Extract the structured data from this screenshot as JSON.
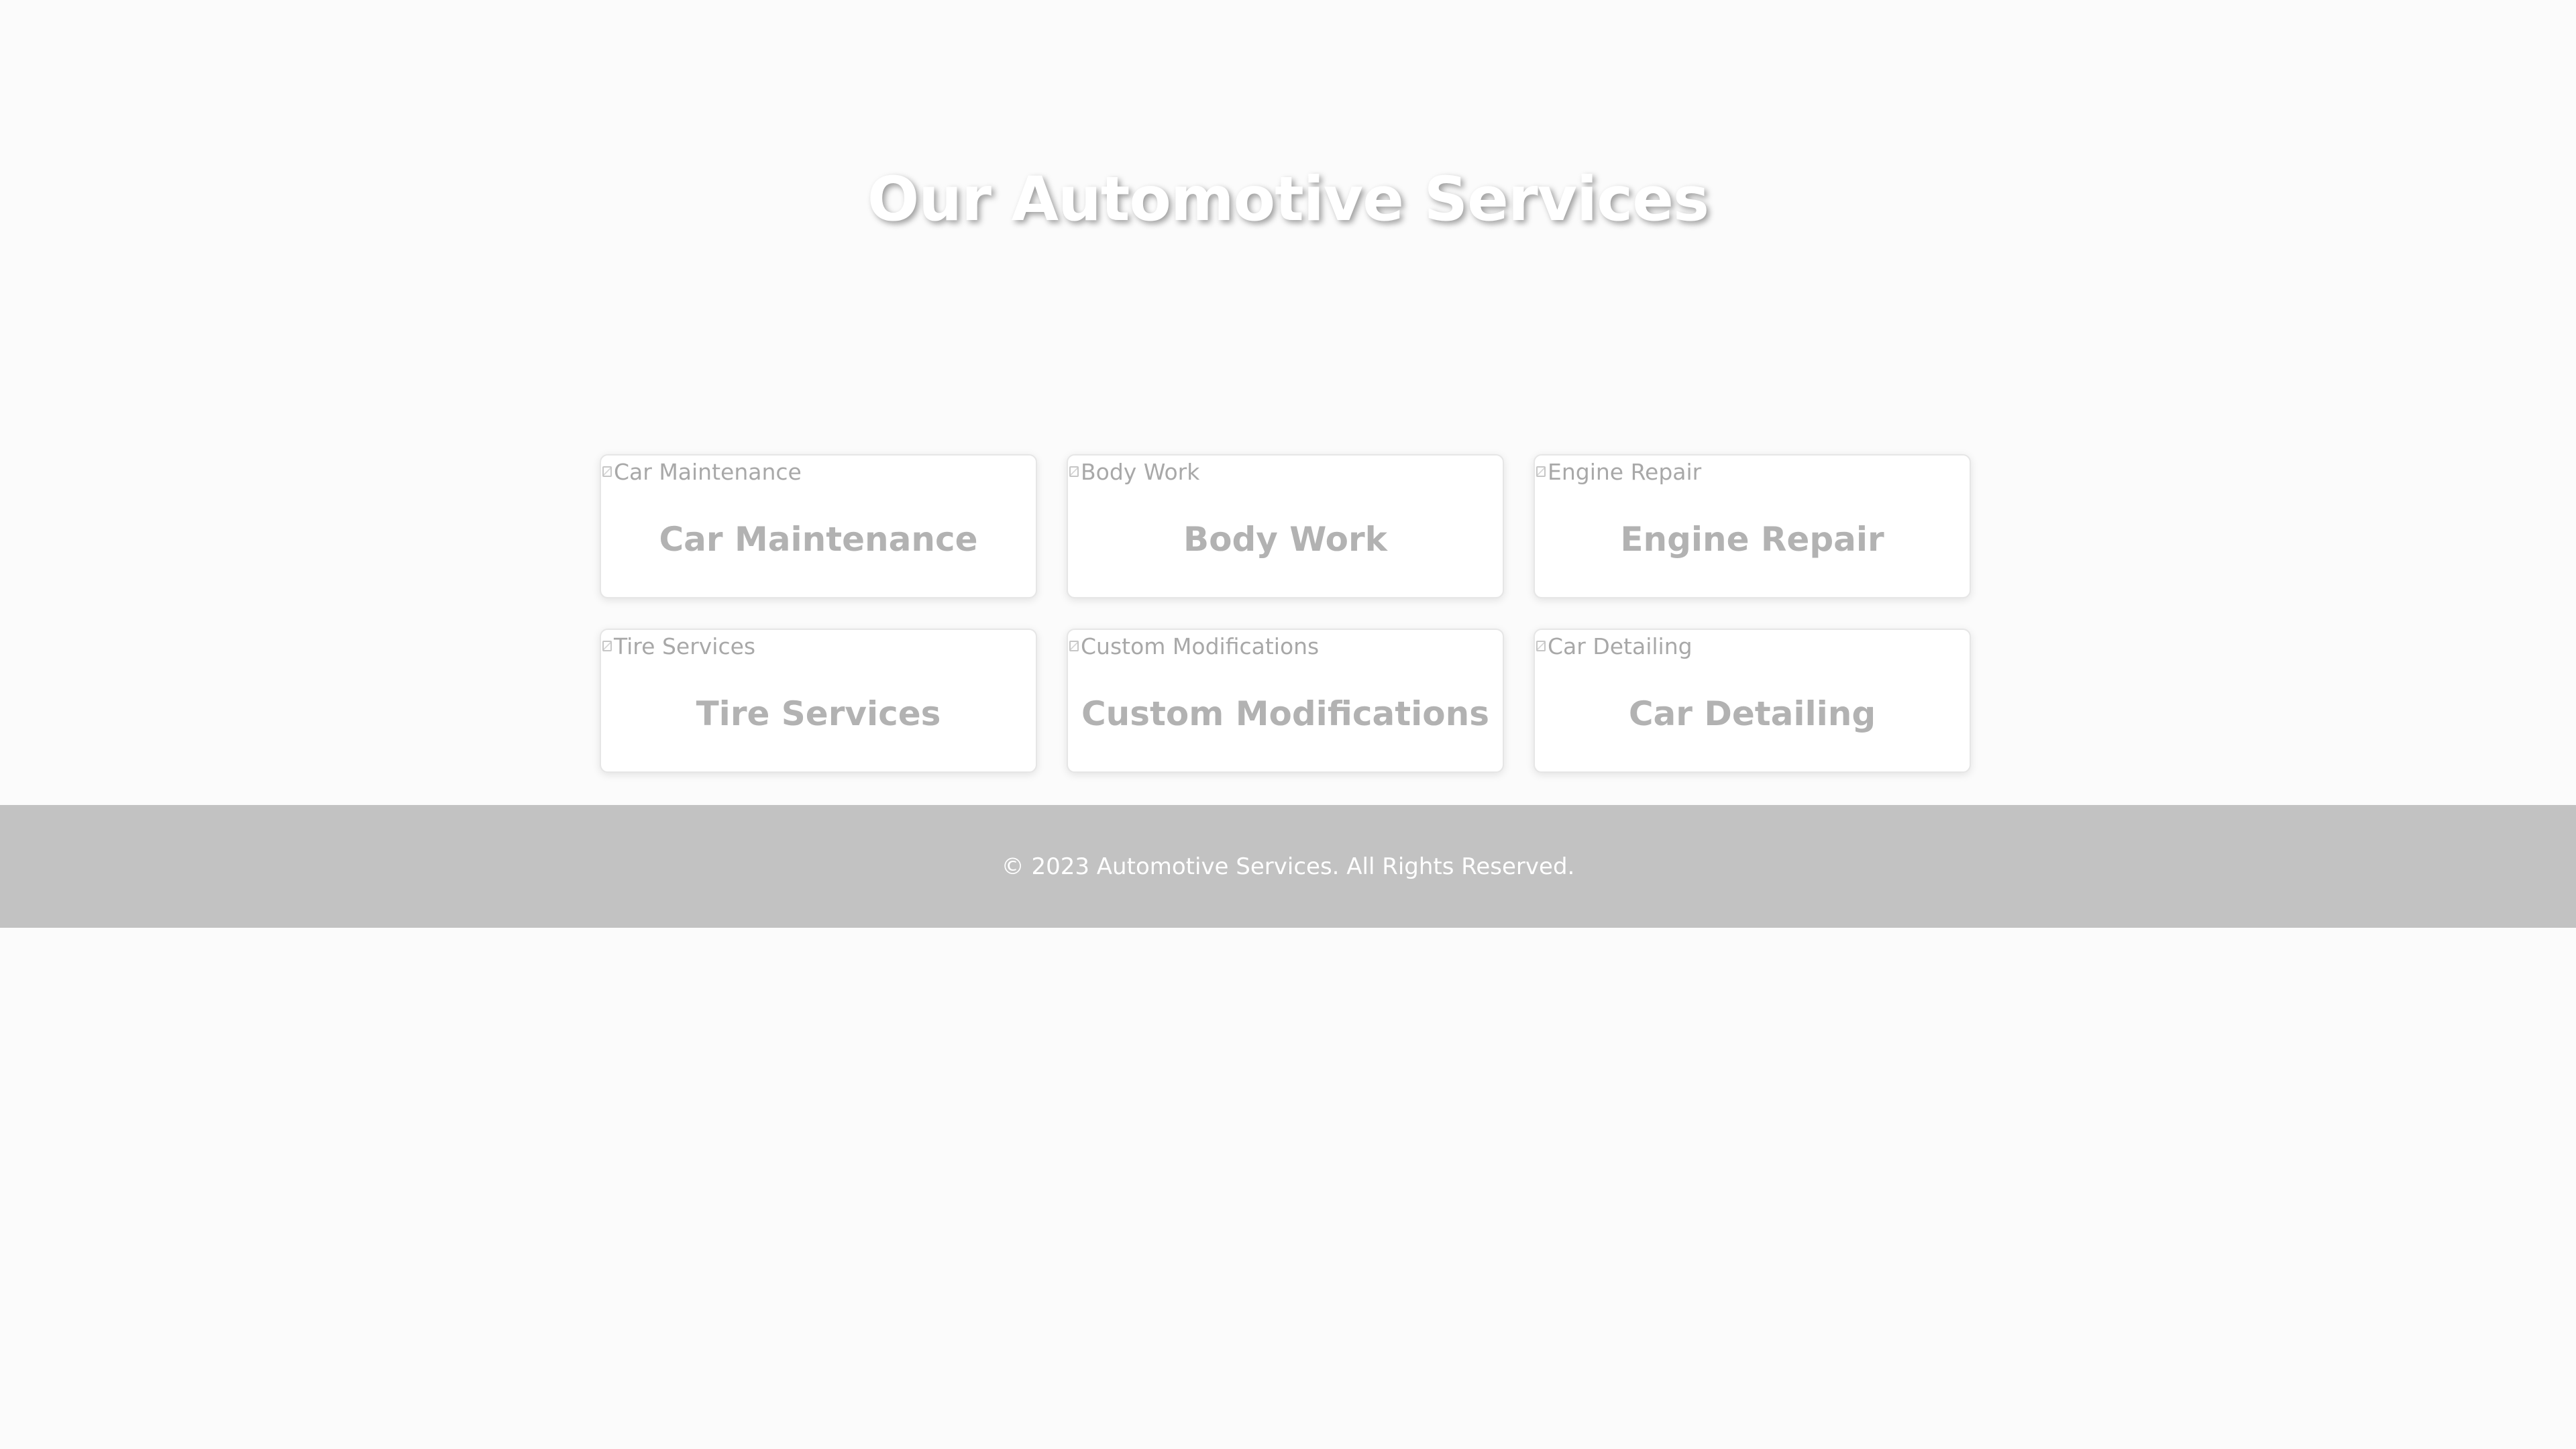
{
  "hero": {
    "title": "Our Automotive Services"
  },
  "services": [
    {
      "image_alt": "Car Maintenance",
      "title": "Car Maintenance"
    },
    {
      "image_alt": "Body Work",
      "title": "Body Work"
    },
    {
      "image_alt": "Engine Repair",
      "title": "Engine Repair"
    },
    {
      "image_alt": "Tire Services",
      "title": "Tire Services"
    },
    {
      "image_alt": "Custom Modifications",
      "title": "Custom Modifications"
    },
    {
      "image_alt": "Car Detailing",
      "title": "Car Detailing"
    }
  ],
  "footer": {
    "text": "© 2023 Automotive Services. All Rights Reserved."
  },
  "colors": {
    "background": "#fbfbfb",
    "card_background": "#ffffff",
    "card_title": "#b2b2b2",
    "footer_background": "#c2c2c2",
    "footer_text": "#ffffff"
  }
}
